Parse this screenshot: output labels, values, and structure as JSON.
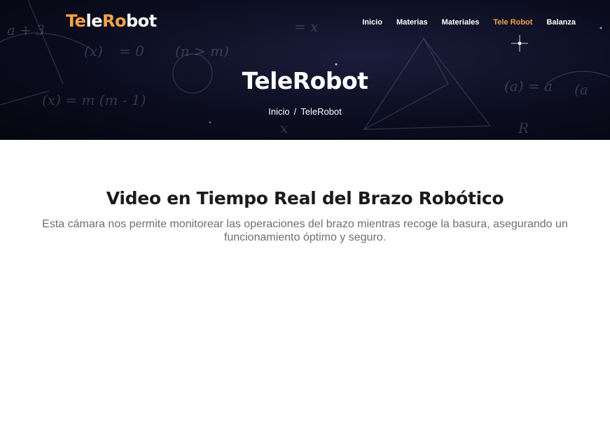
{
  "brand": {
    "part1": "Te",
    "part2": "le",
    "part3": "Ro",
    "part4": "bot"
  },
  "nav": {
    "items": [
      {
        "label": "Inicio",
        "active": false
      },
      {
        "label": "Materias",
        "active": false
      },
      {
        "label": "Materiales",
        "active": false
      },
      {
        "label": "Tele Robot",
        "active": true
      },
      {
        "label": "Balanza",
        "active": false
      }
    ]
  },
  "hero": {
    "title": "TeleRobot",
    "breadcrumb": {
      "home": "Inicio",
      "separator": "/",
      "current": "TeleRobot"
    }
  },
  "section": {
    "title": "Video en Tiempo Real del Brazo Robótico",
    "description": "Esta cámara nos permite monitorear las operaciones del brazo mientras recoge la basura, asegurando un funcionamiento óptimo y seguro."
  },
  "colors": {
    "accent": "#f5a34a",
    "hero_bg": "#0b0d1f",
    "title": "#1b1b1b",
    "text_muted": "#6e6e6e"
  }
}
